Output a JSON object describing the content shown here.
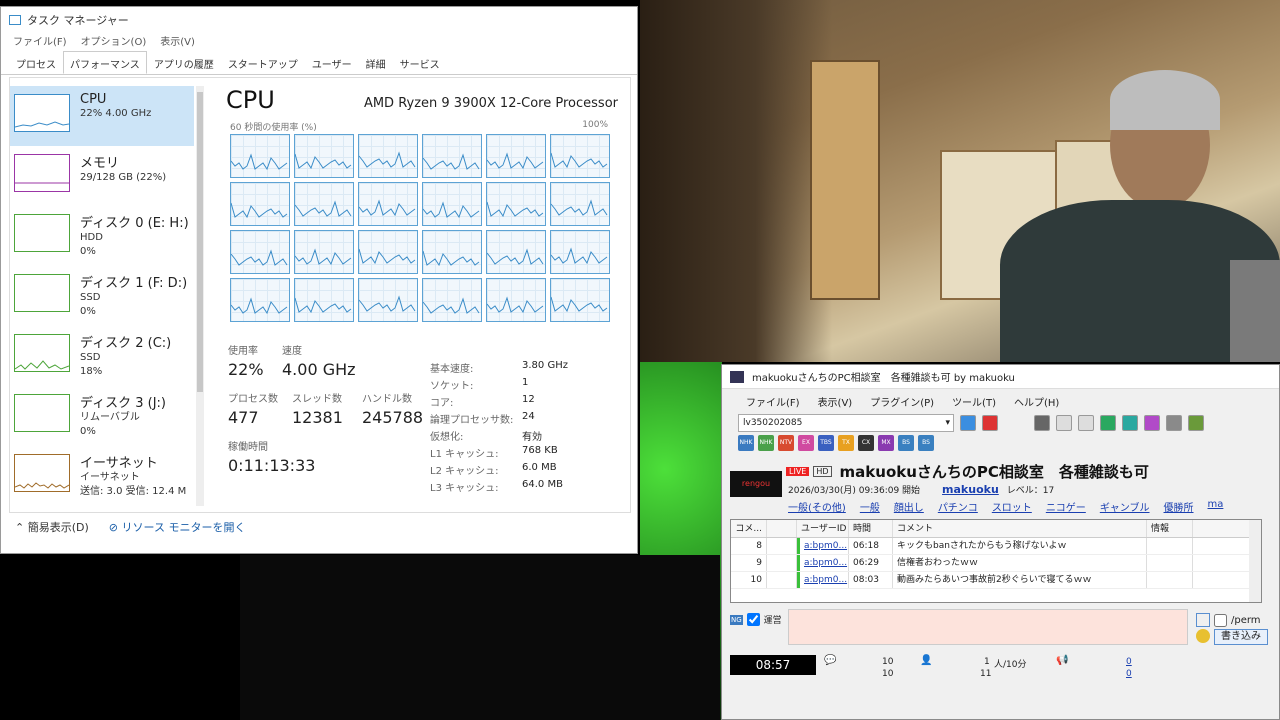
{
  "taskmgr": {
    "title": "タスク マネージャー",
    "menu": [
      "ファイル(F)",
      "オプション(O)",
      "表示(V)"
    ],
    "tabs": [
      "プロセス",
      "パフォーマンス",
      "アプリの履歴",
      "スタートアップ",
      "ユーザー",
      "詳細",
      "サービス"
    ],
    "sidebar": [
      {
        "name": "CPU",
        "sub1": "22% 4.00 GHz",
        "sub2": ""
      },
      {
        "name": "メモリ",
        "sub1": "29/128 GB (22%)",
        "sub2": ""
      },
      {
        "name": "ディスク 0 (E: H:)",
        "sub1": "HDD",
        "sub2": "0%"
      },
      {
        "name": "ディスク 1 (F: D:)",
        "sub1": "SSD",
        "sub2": "0%"
      },
      {
        "name": "ディスク 2 (C:)",
        "sub1": "SSD",
        "sub2": "18%"
      },
      {
        "name": "ディスク 3 (J:)",
        "sub1": "リムーバブル",
        "sub2": "0%"
      },
      {
        "name": "イーサネット",
        "sub1": "イーサネット",
        "sub2": "送信: 3.0 受信: 12.4 M"
      }
    ],
    "cpu_heading": "CPU",
    "cpu_model": "AMD Ryzen 9 3900X 12-Core Processor",
    "graph_label": "60 秒間の使用率 (%)",
    "graph_max": "100%",
    "stats": {
      "usage_label": "使用率",
      "usage": "22%",
      "speed_label": "速度",
      "speed": "4.00 GHz",
      "proc_label": "プロセス数",
      "proc": "477",
      "thread_label": "スレッド数",
      "thread": "12381",
      "handle_label": "ハンドル数",
      "handle": "245788",
      "uptime_label": "稼働時間",
      "uptime": "0:11:13:33"
    },
    "specs": [
      [
        "基本速度:",
        "3.80 GHz"
      ],
      [
        "ソケット:",
        "1"
      ],
      [
        "コア:",
        "12"
      ],
      [
        "論理プロセッサ数:",
        "24"
      ],
      [
        "仮想化:",
        "有効"
      ],
      [
        "L1 キャッシュ:",
        "768 KB"
      ],
      [
        "L2 キャッシュ:",
        "6.0 MB"
      ],
      [
        "L3 キャッシュ:",
        "64.0 MB"
      ]
    ],
    "footer": {
      "compact": "簡易表示(D)",
      "monitor": "リソース モニターを開く"
    }
  },
  "viewer": {
    "title": "makuokuさんちのPC相談室　各種雑談も可 by makuoku",
    "menu": [
      "ファイル(F)",
      "表示(V)",
      "プラグイン(P)",
      "ツール(T)",
      "ヘルプ(H)"
    ],
    "live_id": "lv350202085",
    "badge_live": "LIVE",
    "badge_hd": "HD",
    "live_title": "makuokuさんちのPC相談室　各種雑談も可",
    "start_text": "2026/03/30(月) 09:36:09 開始",
    "owner": "makuoku",
    "level": "レベル：17",
    "tags": [
      "一般(その他)",
      "一般",
      "顔出し",
      "パチンコ",
      "スロット",
      "ニコゲー",
      "ギャンブル",
      "優勝所",
      "ma"
    ],
    "columns": [
      "コメ...",
      "",
      "ユーザーID",
      "時間",
      "コメント",
      "情報"
    ],
    "rows": [
      {
        "no": "8",
        "uid": "a:bpm0...",
        "time": "06:18",
        "text": "キックもbanされたからもう稼げないよｗ"
      },
      {
        "no": "9",
        "uid": "a:bpm0...",
        "time": "06:29",
        "text": "信権者おわったｗｗ"
      },
      {
        "no": "10",
        "uid": "a:bpm0...",
        "time": "08:03",
        "text": "動画みたらあいつ事故前2秒ぐらいで寝てるｗｗ"
      }
    ],
    "ng": "NG",
    "unei": "運営",
    "perm": "/perm",
    "write": "書き込み",
    "clock": "08:57",
    "counts": {
      "c1": "10",
      "c2": "10",
      "v1": "1",
      "v1u": "人/10分",
      "v2": "11",
      "l1": "0",
      "l2": "0"
    }
  },
  "colors": {
    "cpu": "#3a8cc8",
    "mem": "#9b35a6",
    "disk": "#4da53a",
    "net": "#a06c2a"
  }
}
